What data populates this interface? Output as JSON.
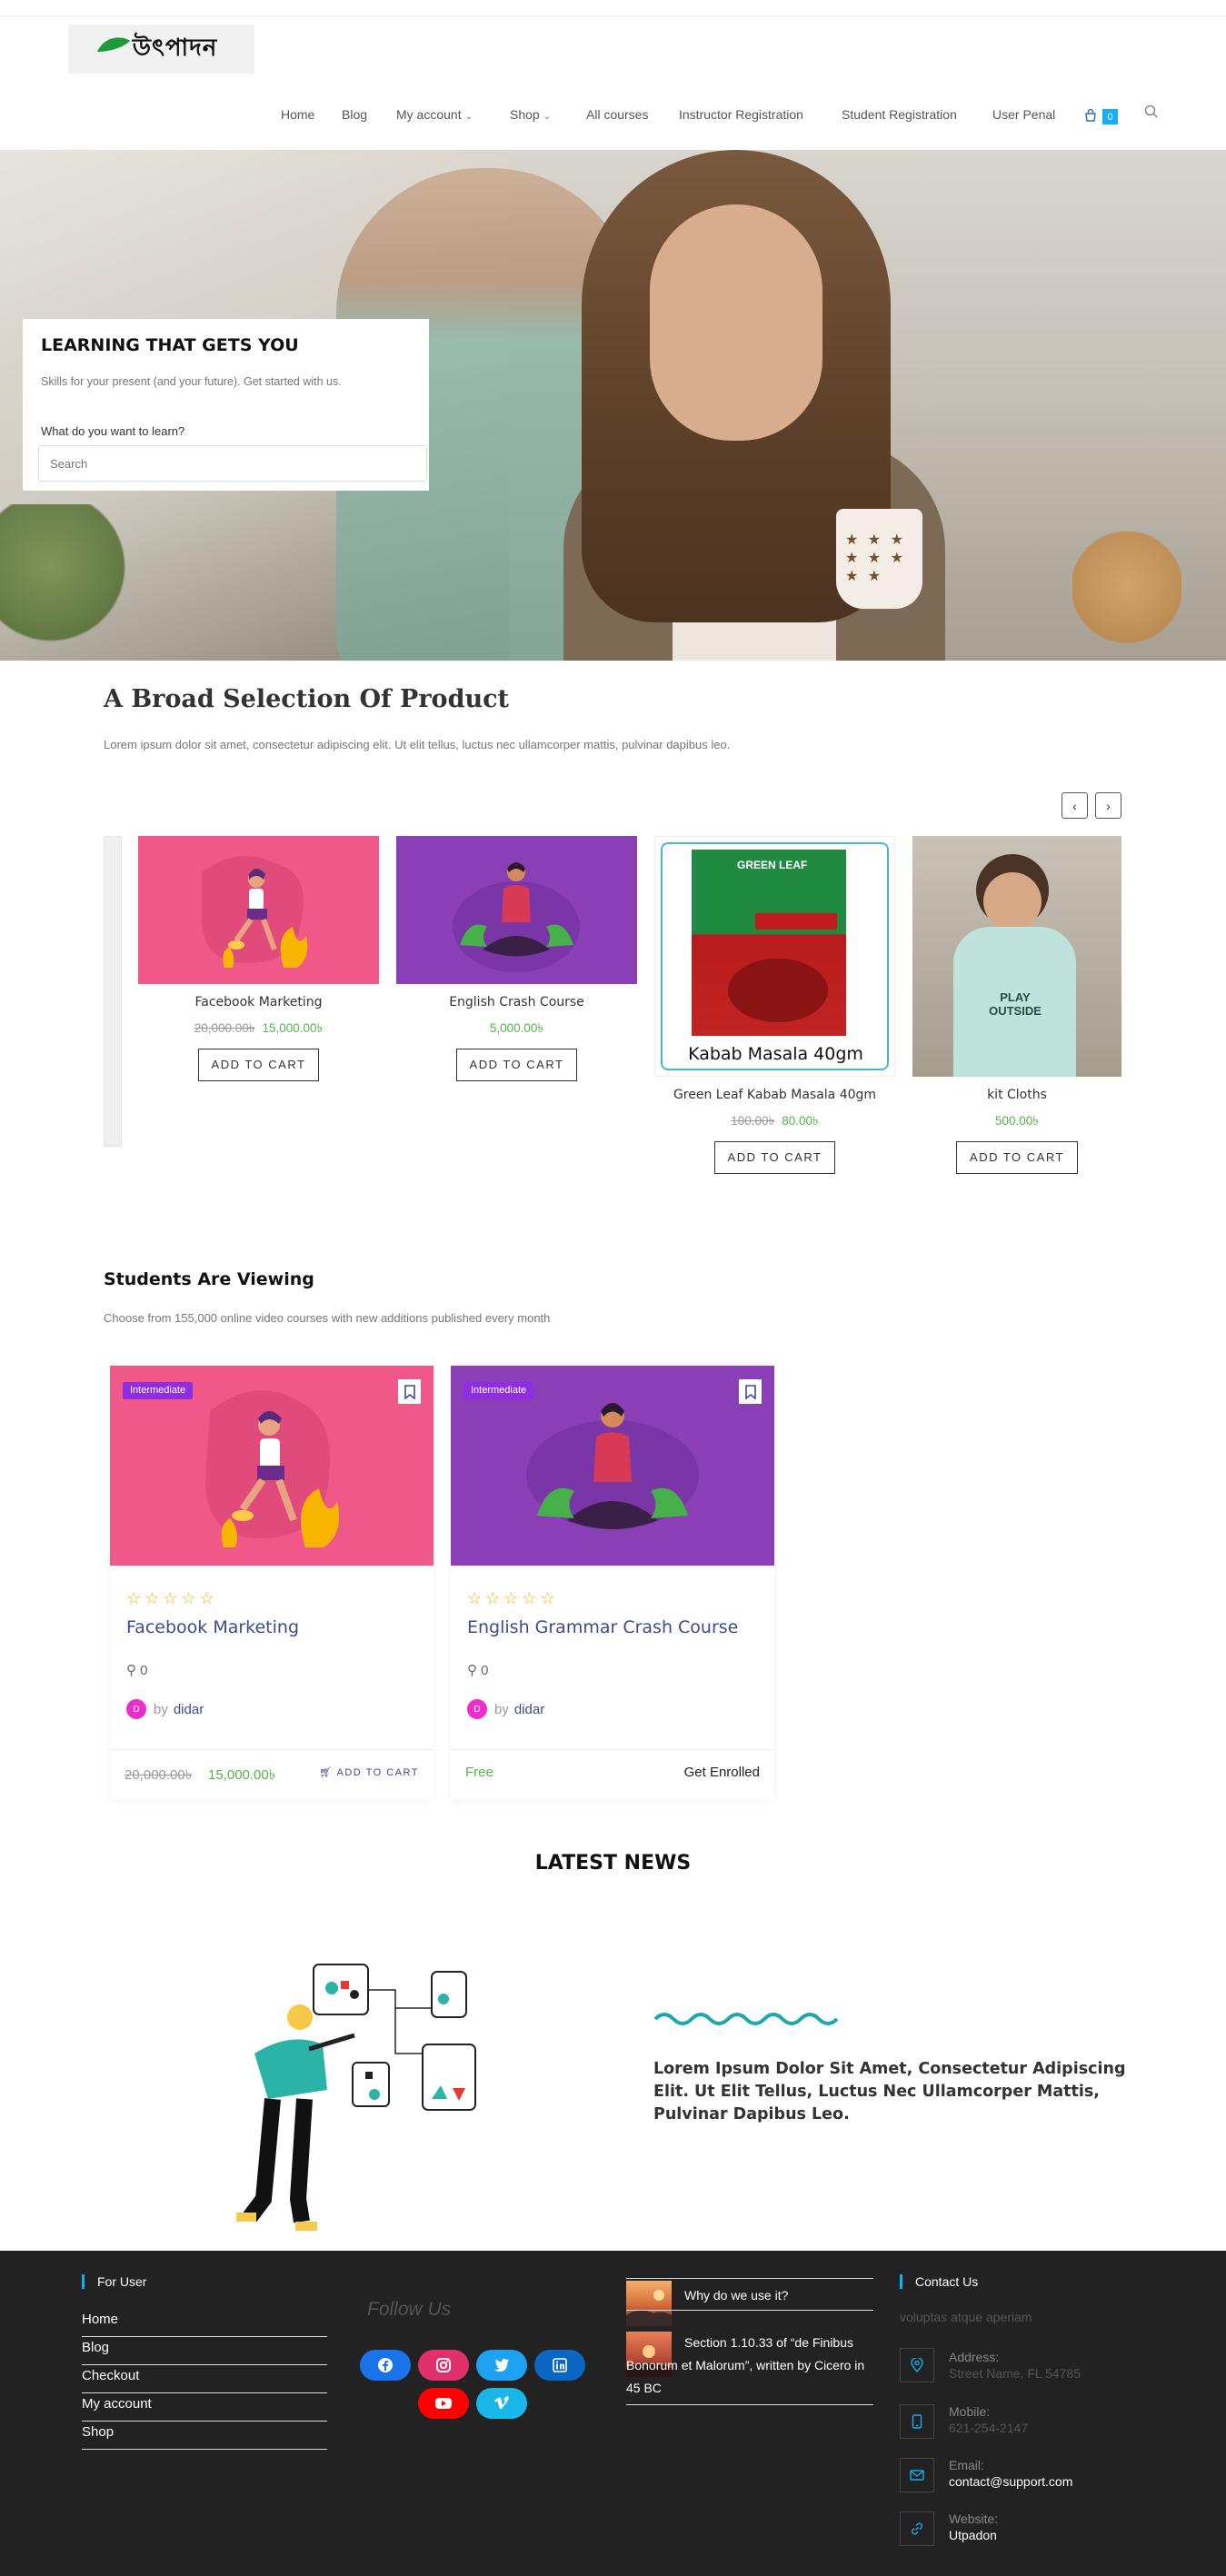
{
  "header": {
    "logo_text": "উৎপাদন",
    "nav": [
      {
        "label": "Home",
        "dropdown": false
      },
      {
        "label": "Blog",
        "dropdown": false
      },
      {
        "label": "My account",
        "dropdown": true
      },
      {
        "label": "Shop",
        "dropdown": true
      },
      {
        "label": "All courses",
        "dropdown": false
      },
      {
        "label": "Instructor Registration",
        "dropdown": false
      },
      {
        "label": "Student Registration",
        "dropdown": false
      },
      {
        "label": "User Penal",
        "dropdown": false
      }
    ],
    "cart_count": "0",
    "icons": [
      "cart-icon",
      "search-icon"
    ],
    "accent_color": "#13aff0"
  },
  "hero": {
    "title": "LEARNING THAT GETS YOU",
    "subtitle": "Skills for your present (and your future). Get started with us.",
    "search_label": "What do you want to learn?",
    "search_placeholder": "Search"
  },
  "products_section": {
    "title": "A Broad Selection Of Product",
    "description": "Lorem ipsum dolor sit amet, consectetur adipiscing elit. Ut elit tellus, luctus nec ullamcorper mattis, pulvinar dapibus leo.",
    "prev_icon": "‹",
    "next_icon": "›",
    "products": [
      {
        "name": "Facebook Marketing",
        "old_price": "20,000.00৳",
        "price": "15,000.00৳",
        "button": "ADD TO CART"
      },
      {
        "name": "English Crash Course",
        "old_price": "",
        "price": "5,000.00৳",
        "button": "ADD TO CART"
      },
      {
        "name": "Green Leaf Kabab Masala 40gm",
        "old_price": "100.00৳",
        "price": "80.00৳",
        "button": "ADD TO CART",
        "image_caption": "Kabab Masala 40gm",
        "image_brand": "GREEN LEAF"
      },
      {
        "name": "kit Cloths",
        "old_price": "",
        "price": "500.00৳",
        "button": "ADD TO CART",
        "image_caption": "PLAY OUTSIDE"
      }
    ]
  },
  "courses_section": {
    "title": "Students Are Viewing",
    "description": "Choose from 155,000 online video courses with new additions published every month",
    "courses": [
      {
        "level": "Intermediate",
        "stars": "☆☆☆☆☆",
        "title": "Facebook Marketing",
        "students": "0",
        "author_initial": "D",
        "by": "by",
        "author": "didar",
        "old_price": "20,000.00৳",
        "price": "15,000.00৳",
        "action": "ADD TO CART"
      },
      {
        "level": "Intermediate",
        "stars": "☆☆☆☆☆",
        "title": "English Grammar Crash Course",
        "students": "0",
        "author_initial": "D",
        "by": "by",
        "author": "didar",
        "price": "Free",
        "action": "Get Enrolled"
      }
    ]
  },
  "news_section": {
    "title": "LATEST NEWS",
    "headline": "Lorem Ipsum Dolor Sit Amet, Consectetur Adipiscing Elit. Ut Elit Tellus, Luctus Nec Ullamcorper Mattis, Pulvinar Dapibus Leo."
  },
  "footer": {
    "for_user_title": "For User",
    "links": [
      "Home",
      "Blog",
      "Checkout",
      "My account",
      "Shop"
    ],
    "follow_title": "Follow Us",
    "social": [
      "facebook-icon",
      "instagram-icon",
      "twitter-icon",
      "linkedin-icon",
      "youtube-icon",
      "vimeo-icon"
    ],
    "social_colors": [
      "#1a73e8",
      "#e1306c",
      "#1da1f2",
      "#0a66c2",
      "#ff0000",
      "#1ab7ea"
    ],
    "posts": [
      {
        "title": "Why do we use it?"
      },
      {
        "title": "Section 1.10.33 of “de Finibus Bonorum et Malorum”, written by Cicero in 45 BC"
      }
    ],
    "contact_title": "Contact Us",
    "contact_desc": "voluptas atque aperiam",
    "contacts": [
      {
        "icon": "location-icon",
        "label": "Address:",
        "value": "Street Name, FL 54785",
        "dim": true
      },
      {
        "icon": "mobile-icon",
        "label": "Mobile:",
        "value": "621-254-2147",
        "dim": true
      },
      {
        "icon": "email-icon",
        "label": "Email:",
        "value": "contact@support.com",
        "dim": false
      },
      {
        "icon": "link-icon",
        "label": "Website:",
        "value": "Utpadon",
        "dim": false
      }
    ]
  }
}
